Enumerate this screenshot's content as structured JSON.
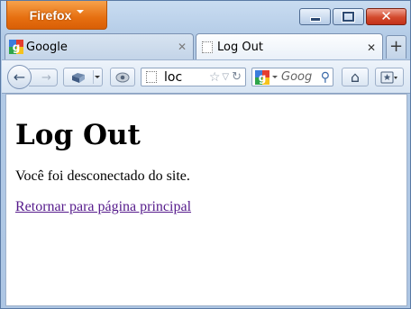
{
  "browser": {
    "menu_button_label": "Firefox",
    "window_controls": {
      "minimize_icon": "minimize-icon",
      "maximize_icon": "maximize-icon",
      "close_icon": "close-icon",
      "close_glyph": "✕"
    },
    "tabs": [
      {
        "title": "Google",
        "favicon": "google-favicon",
        "close_glyph": "✕",
        "active": false
      },
      {
        "title": "Log Out",
        "favicon": "blank-page-icon",
        "close_glyph": "✕",
        "active": true
      }
    ],
    "new_tab_glyph": "+",
    "navbar": {
      "back_glyph": "←",
      "forward_glyph": "→",
      "url_value": "loc",
      "search_placeholder": "Goog",
      "star_glyph": "☆",
      "url_dropdown_glyph": "▽",
      "reload_glyph": "↻",
      "search_glyph": "⚲",
      "home_glyph": "⌂"
    }
  },
  "page": {
    "heading": "Log Out",
    "message": "Você foi desconectado do site.",
    "link_label": "Retornar para página principal"
  },
  "colors": {
    "accent_orange": "#e66f10",
    "close_red": "#d2492c",
    "visited_link": "#551a8b"
  }
}
